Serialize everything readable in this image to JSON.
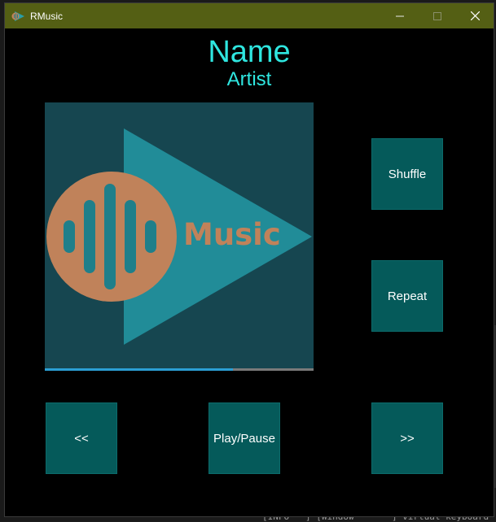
{
  "window": {
    "title": "RMusic",
    "titlebar_color": "#545f14"
  },
  "player": {
    "song_name": "Name",
    "artist": "Artist",
    "progress": 0.7,
    "accent_color": "#2fe6e0",
    "button_color": "#055a5a"
  },
  "cover_art": {
    "logo_text": "Music"
  },
  "controls": {
    "shuffle_label": "Shuffle",
    "repeat_label": "Repeat",
    "prev_label": "<<",
    "play_pause_label": "Play/Pause",
    "next_label": ">>"
  },
  "background_terminal": {
    "text": "[INFO   ] [Window       ] virtual keyboard"
  }
}
